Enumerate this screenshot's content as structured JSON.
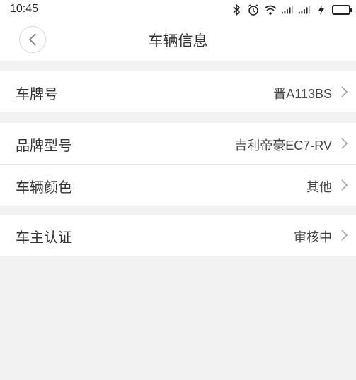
{
  "status_bar": {
    "time": "10:45",
    "icons": [
      "bluetooth-icon",
      "alarm-icon",
      "wifi-icon",
      "signal-icon",
      "signal-icon",
      "charging-icon",
      "battery-icon"
    ],
    "battery_color": "#2ecb2e"
  },
  "nav": {
    "title": "车辆信息",
    "back_icon": "chevron-left-icon"
  },
  "rows": [
    {
      "label": "车牌号",
      "value": "晋A113BS"
    },
    {
      "label": "品牌型号",
      "value": "吉利帝豪EC7-RV"
    },
    {
      "label": "车辆颜色",
      "value": "其他"
    },
    {
      "label": "车主认证",
      "value": "审核中"
    }
  ],
  "colors": {
    "background": "#f2f2f2",
    "card": "#ffffff",
    "text": "#333333",
    "chevron": "#9a9a9a"
  }
}
